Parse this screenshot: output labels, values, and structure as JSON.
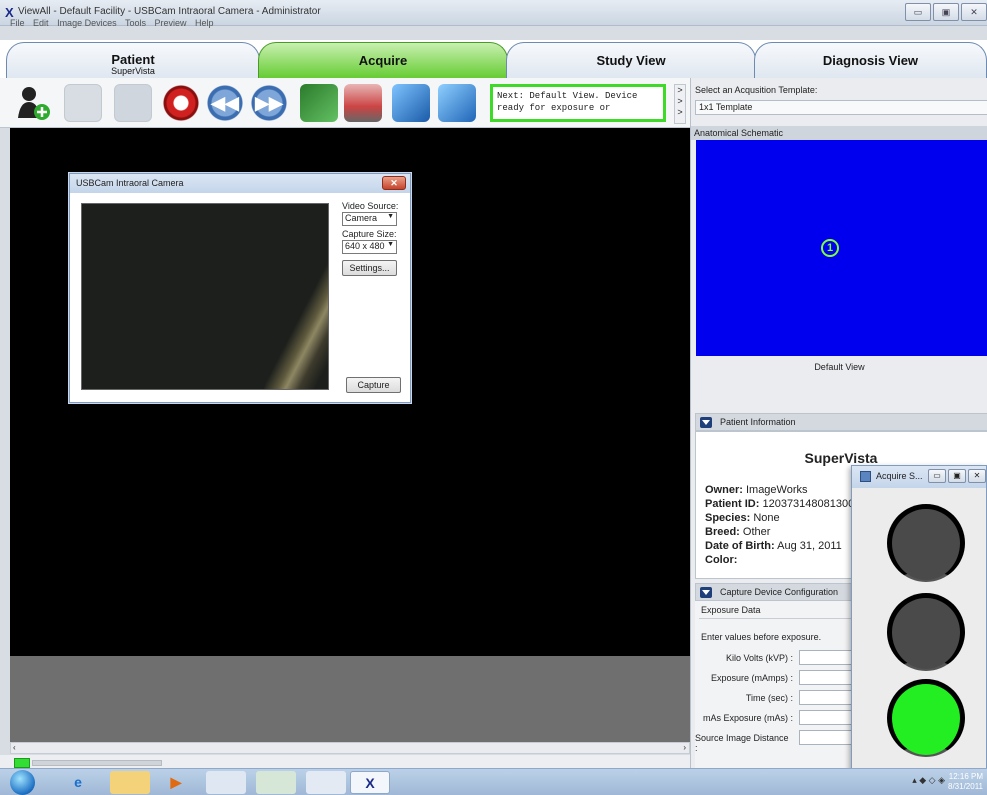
{
  "window": {
    "title": "ViewAll - Default Facility - USBCam Intraoral Camera - Administrator",
    "app_icon": "X",
    "menu": [
      "File",
      "Edit",
      "Image Devices",
      "Tools",
      "Preview",
      "Help"
    ],
    "controls": {
      "minimize": "▭",
      "maximize": "▣",
      "close": "✕"
    }
  },
  "tabs": [
    {
      "label": "Patient",
      "sub": "SuperVista",
      "active": false
    },
    {
      "label": "Acquire",
      "sub": "",
      "active": true
    },
    {
      "label": "Study View",
      "sub": "",
      "active": false
    },
    {
      "label": "Diagnosis View",
      "sub": "",
      "active": false
    }
  ],
  "toolbar": {
    "icons": [
      "add-patient-icon",
      "document-icon",
      "document-icon",
      "stop-icon",
      "rewind-icon",
      "fast-forward-icon",
      "rotate-icon",
      "xray-sensor-icon",
      "mirror-left-icon",
      "mirror-right-icon"
    ],
    "prev_glyph": "◀◀",
    "next_glyph": "▶▶",
    "next_message": "Next: Default View.  Device ready for exposure or",
    "next_scroll": [
      ">",
      ">",
      ">"
    ]
  },
  "template": {
    "label": "Select an Acqusition Template:",
    "value": "1x1 Template"
  },
  "anatomical": {
    "header": "Anatomical Schematic",
    "marker": "1",
    "caption": "Default View",
    "color": "#0000ee"
  },
  "patient_info": {
    "header": "Patient Information",
    "name": "SuperVista",
    "owner_label": "Owner:",
    "owner": "ImageWorks",
    "id_label": "Patient ID:",
    "id": "120373148081300",
    "species_label": "Species:",
    "species": "None",
    "breed_label": "Breed:",
    "breed": "Other",
    "dob_label": "Date of Birth:",
    "dob": "Aug 31, 2011",
    "color_label": "Color:",
    "color": ""
  },
  "capture_config": {
    "header": "Capture Device Configuration",
    "section": "Exposure Data",
    "hint": "Enter values before exposure.",
    "fields": [
      {
        "label": "Kilo Volts (kVP) :",
        "value": ""
      },
      {
        "label": "Exposure (mAmps) :",
        "value": ""
      },
      {
        "label": "Time (sec) :",
        "value": ""
      },
      {
        "label": "mAs Exposure (mAs) :",
        "value": ""
      },
      {
        "label": "Source Image Distance :",
        "value": ""
      }
    ]
  },
  "camera_dialog": {
    "title": "USBCam Intraoral Camera",
    "close": "✕",
    "video_source_label": "Video Source:",
    "video_source": "Camera",
    "capture_size_label": "Capture Size:",
    "capture_size": "640 x 480",
    "settings_button": "Settings...",
    "capture_button": "Capture"
  },
  "acquire_window": {
    "title": "Acquire S...",
    "lights": [
      "off",
      "off",
      "on"
    ],
    "active_color": "#22ee22",
    "controls": [
      "▭",
      "▣",
      "✕"
    ]
  },
  "scrollbar": {
    "left": "‹",
    "right": "›"
  },
  "taskbar": {
    "apps": [
      "ie-icon",
      "explorer-icon",
      "media-icon",
      "paint-icon",
      "network-icon",
      "app-icon",
      "viewall-icon"
    ],
    "viewall_glyph": "X",
    "time": "12:16 PM",
    "date": "8/31/2011"
  }
}
